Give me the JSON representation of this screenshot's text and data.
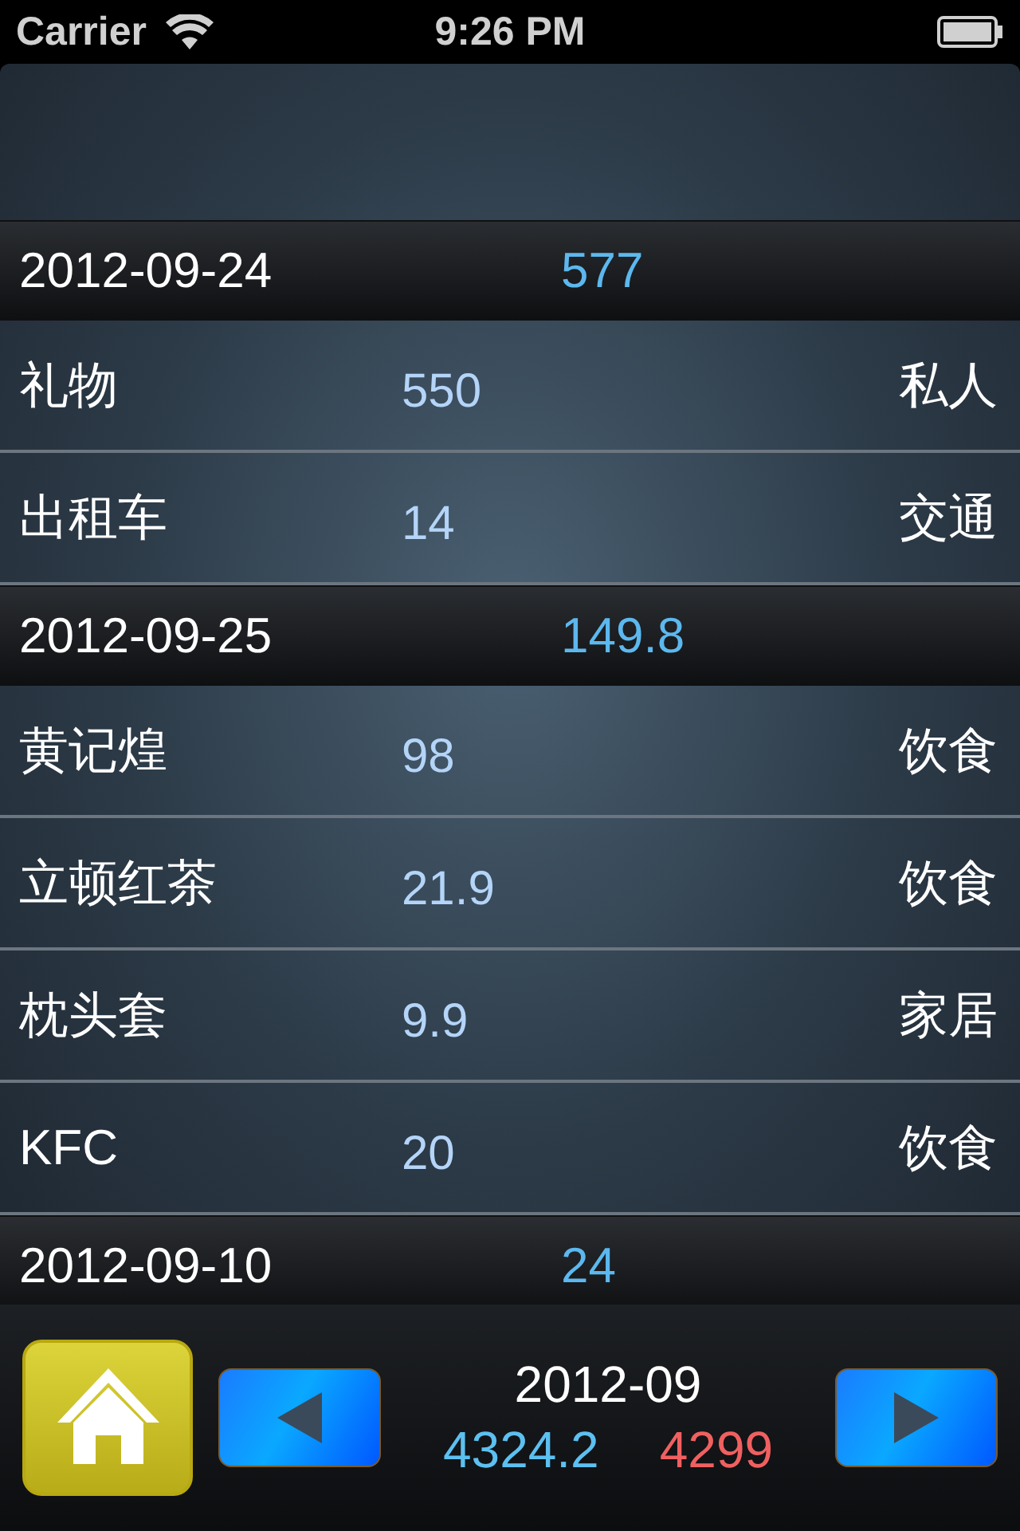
{
  "status_bar": {
    "carrier": "Carrier",
    "time": "9:26 PM"
  },
  "sections": [
    {
      "date": "2012-09-24",
      "total": "577",
      "items": [
        {
          "name": "礼物",
          "amount": "550",
          "category": "私人"
        },
        {
          "name": "出租车",
          "amount": "14",
          "category": "交通"
        }
      ]
    },
    {
      "date": "2012-09-25",
      "total": "149.8",
      "items": [
        {
          "name": "黄记煌",
          "amount": "98",
          "category": "饮食"
        },
        {
          "name": "立顿红茶",
          "amount": "21.9",
          "category": "饮食"
        },
        {
          "name": "枕头套",
          "amount": "9.9",
          "category": "家居"
        },
        {
          "name": "KFC",
          "amount": "20",
          "category": "饮食"
        }
      ]
    },
    {
      "date": "2012-09-10",
      "total": "24"
    }
  ],
  "footer": {
    "month": "2012-09",
    "income": "4324.2",
    "expense": "4299"
  }
}
